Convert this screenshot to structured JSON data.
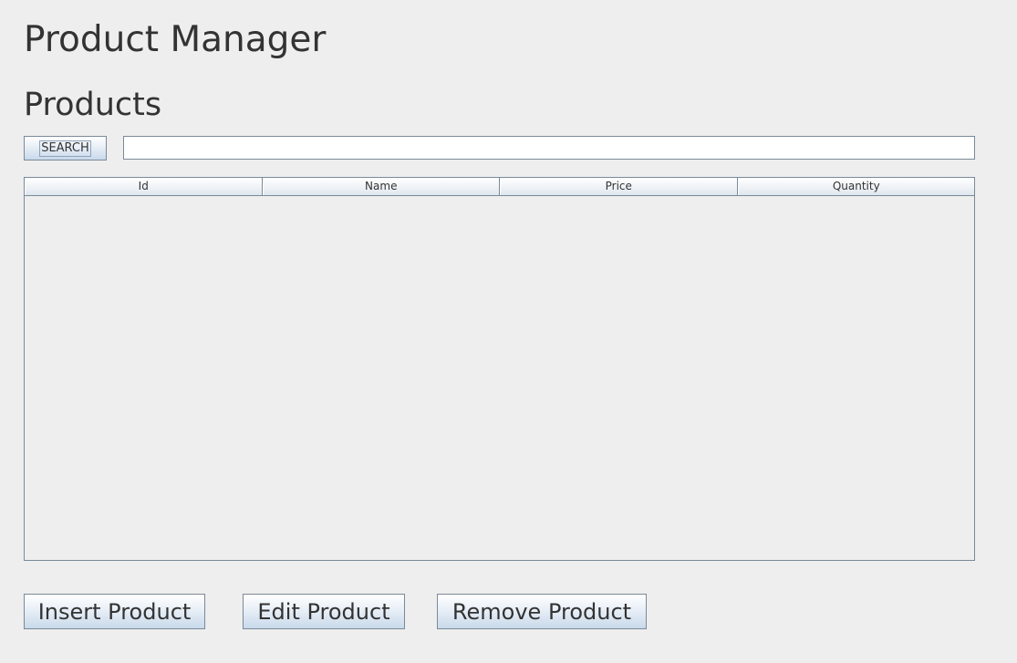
{
  "app": {
    "title": "Product Manager"
  },
  "section": {
    "title": "Products"
  },
  "search": {
    "button_label": "SEARCH",
    "value": "",
    "placeholder": ""
  },
  "table": {
    "columns": [
      "Id",
      "Name",
      "Price",
      "Quantity"
    ],
    "rows": []
  },
  "actions": {
    "insert_label": "Insert Product",
    "edit_label": "Edit Product",
    "remove_label": "Remove Product"
  },
  "colors": {
    "background": "#eeeeee",
    "border": "#7a8a99",
    "button_gradient_bottom": "#c9d9ea",
    "text": "#333333"
  }
}
